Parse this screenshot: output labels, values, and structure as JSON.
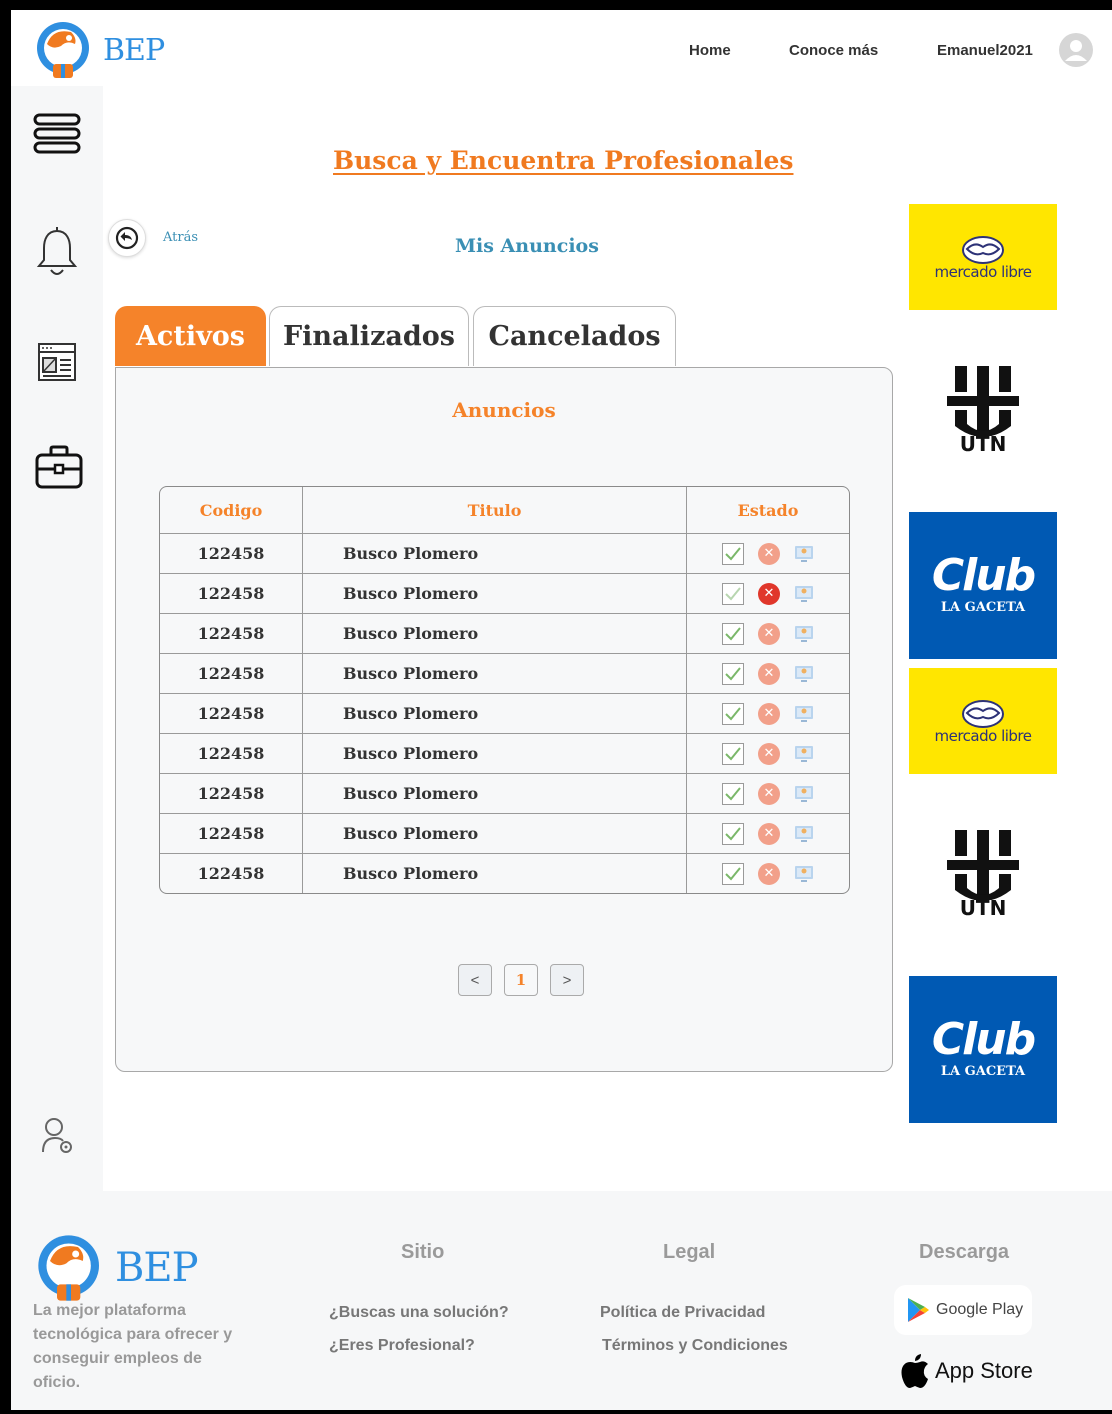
{
  "header": {
    "logo_text": "BEP",
    "nav": {
      "home": "Home",
      "more": "Conoce más"
    },
    "username": "Emanuel2021"
  },
  "sidebar": {
    "icons": [
      "menu-icon",
      "bell-icon",
      "browser-window-icon",
      "briefcase-icon",
      "user-settings-icon"
    ]
  },
  "main": {
    "title": "Busca y Encuentra Profesionales",
    "back_label": "Atrás",
    "subtitle": "Mis Anuncios",
    "tabs": [
      {
        "label": "Activos",
        "active": true
      },
      {
        "label": "Finalizados",
        "active": false
      },
      {
        "label": "Cancelados",
        "active": false
      }
    ],
    "panel_title": "Anuncios",
    "table": {
      "columns": [
        "Codigo",
        "Titulo",
        "Estado"
      ],
      "rows": [
        {
          "code": "122458",
          "title": "Busco Plomero"
        },
        {
          "code": "122458",
          "title": "Busco Plomero"
        },
        {
          "code": "122458",
          "title": "Busco Plomero"
        },
        {
          "code": "122458",
          "title": "Busco Plomero"
        },
        {
          "code": "122458",
          "title": "Busco Plomero"
        },
        {
          "code": "122458",
          "title": "Busco Plomero"
        },
        {
          "code": "122458",
          "title": "Busco Plomero"
        },
        {
          "code": "122458",
          "title": "Busco Plomero"
        },
        {
          "code": "122458",
          "title": "Busco Plomero"
        }
      ]
    },
    "pagination": {
      "prev": "<",
      "current": "1",
      "next": ">"
    }
  },
  "ads": {
    "mercado_libre": "mercado libre",
    "utn": "UTN",
    "club_main": "Club",
    "club_sub": "LA GACETA"
  },
  "footer": {
    "logo_text": "BEP",
    "description": "La mejor plataforma tecnológica para ofrecer y conseguir empleos de oficio.",
    "sitio": {
      "heading": "Sitio",
      "links": [
        "¿Buscas una solución?",
        "¿Eres Profesional?"
      ]
    },
    "legal": {
      "heading": "Legal",
      "links": [
        "Política de Privacidad",
        "Términos y Condiciones"
      ]
    },
    "descarga": {
      "heading": "Descarga",
      "google_play": "Google Play",
      "app_store": "App Store"
    }
  },
  "colors": {
    "accent": "#f5832a",
    "link_blue": "#3a8fb4",
    "brand_blue": "#2f8fe0",
    "ml_yellow": "#ffe600",
    "club_blue": "#0059b3"
  }
}
